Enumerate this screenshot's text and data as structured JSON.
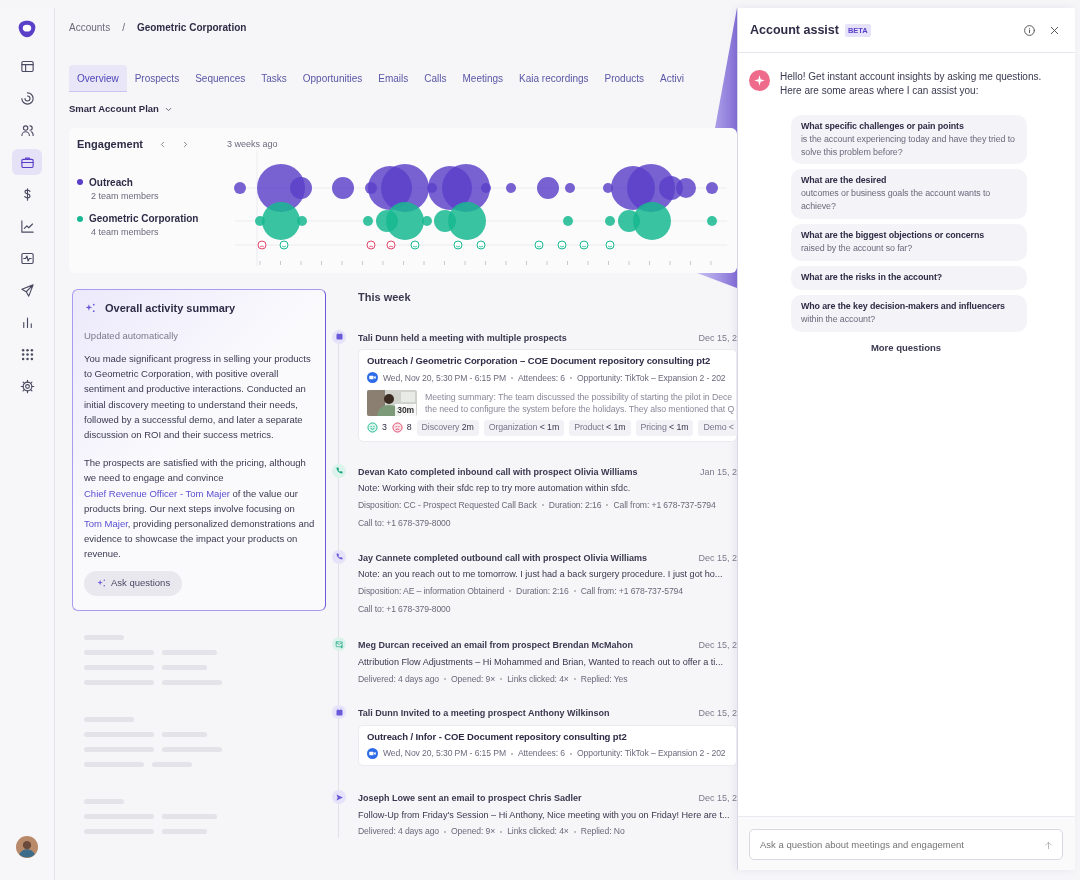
{
  "sidebar": {
    "items": [
      {
        "kind": "layout",
        "selected": false
      },
      {
        "kind": "spiral",
        "selected": false
      },
      {
        "kind": "people",
        "selected": false
      },
      {
        "kind": "briefcase",
        "selected": true
      },
      {
        "kind": "dollar",
        "selected": false
      },
      {
        "kind": "trend",
        "selected": false
      },
      {
        "kind": "pulse",
        "selected": false
      },
      {
        "kind": "send",
        "selected": false
      },
      {
        "kind": "bars",
        "selected": false
      },
      {
        "kind": "apps",
        "selected": false
      },
      {
        "kind": "settings",
        "selected": false
      }
    ]
  },
  "breadcrumb": {
    "items": [
      "Accounts",
      "Geometric Corporation"
    ],
    "separator": "/"
  },
  "tabs": [
    {
      "label": "Overview",
      "selected": true
    },
    {
      "label": "Prospects",
      "selected": false
    },
    {
      "label": "Sequences",
      "selected": false
    },
    {
      "label": "Tasks",
      "selected": false
    },
    {
      "label": "Opportunities",
      "selected": false
    },
    {
      "label": "Emails",
      "selected": false
    },
    {
      "label": "Calls",
      "selected": false
    },
    {
      "label": "Meetings",
      "selected": false
    },
    {
      "label": "Kaia recordings",
      "selected": false
    },
    {
      "label": "Products",
      "selected": false
    },
    {
      "label": "Activi",
      "selected": false
    }
  ],
  "plan_selector": {
    "label": "Smart Account Plan"
  },
  "engagement": {
    "title": "Engagement",
    "period": "3 weeks ago",
    "legend": [
      {
        "name": "Outreach",
        "members": "2 team members",
        "color": "#5a3fc8"
      },
      {
        "name": "Geometric Corporation",
        "members": "4 team members",
        "color": "#17b890"
      }
    ]
  },
  "summary": {
    "title": "Overall activity summary",
    "updated": "Updated automatically",
    "paragraphs": [
      [
        {
          "kind": "text",
          "text": "You made significant progress in selling your products to Geometric Corporation, with positive overall sentiment and productive interactions. Conducted an initial discovery meeting to understand their needs, followed by a successful demo, and later a separate discussion on ROI and their success metrics."
        }
      ],
      [
        {
          "kind": "text",
          "text": "The prospects are satisfied with the pricing, although we need to engage and convince "
        },
        {
          "kind": "link",
          "text": "Chief Revenue Officer - Tom Majer"
        },
        {
          "kind": "text",
          "text": " of the value our products bring. Our next steps involve focusing on "
        },
        {
          "kind": "link",
          "text": "Tom Majer"
        },
        {
          "kind": "text",
          "text": ", providing personalized demonstrations and evidence to showcase the impact your products on revenue."
        }
      ]
    ],
    "button": "Ask questions"
  },
  "timeline": {
    "heading": "This week",
    "events": [
      {
        "kind": "meeting",
        "headline": "Tali Dunn held a meeting with multiple prospects",
        "date": "Dec 15, 2",
        "meeting": {
          "title": "Outreach / Geometric Corporation – COE Document repository consulting pt2",
          "meta": [
            "Wed, Nov 20, 5:30 PM - 6:15 PM",
            "Attendees: 6",
            "Opportunity: TikTok – Expansion 2 - 202"
          ],
          "duration": "30m",
          "summary": [
            "Meeting summary: The team discussed the possibility of starting the pilot in Dece",
            "the need to configure the system before the holidays. They also mentioned that Q"
          ],
          "positive": "3",
          "negative": "8",
          "topics": [
            "Discovery **2m**",
            "Organization **< 1m**",
            "Product **< 1m**",
            "Pricing **< 1m**",
            "Demo <"
          ]
        }
      },
      {
        "kind": "inbound_call",
        "headline": "Devan Kato completed inbound call with prospect Olivia Williams",
        "date": "Jan 15, 2",
        "note": "Note: Working with their sfdc rep to try more automation within sfdc.",
        "meta_lines": [
          [
            "Disposition: CC - Prospect Requested Call Back",
            "Duration: 2:16",
            "Call from: +1 678-737-5794"
          ],
          [
            "Call to:  +1 678-379-8000"
          ]
        ]
      },
      {
        "kind": "outbound_call",
        "headline": "Jay Cannete completed outbound call with prospect Olivia Williams",
        "date": "Dec 15, 2",
        "note": "Note: an you reach out to me tomorrow. I just had a back surgery procedure. I just got ho...",
        "meta_lines": [
          [
            "Disposition: AE – information Obtainerd",
            "Duration: 2:16",
            "Call from: +1 678-737-5794"
          ],
          [
            "Call to:  +1 678-379-8000"
          ]
        ]
      },
      {
        "kind": "email_received",
        "headline": "Meg Durcan received an email from prospect Brendan McMahon",
        "date": "Dec 15, 2",
        "note": "Attribution Flow Adjustments – Hi Mohammed and Brian, Wanted to reach out to offer a ti...",
        "meta_lines": [
          [
            "Delivered: 4 days ago",
            "Opened: 9×",
            "Links clicked: 4×",
            "Replied: Yes"
          ]
        ]
      },
      {
        "kind": "meeting_invite",
        "headline": "Tali Dunn Invited to a meeting prospect Anthony Wilkinson",
        "date": "Dec 15, 2",
        "meeting": {
          "title": "Outreach / Infor - COE Document repository consulting pt2",
          "meta": [
            "Wed, Nov 20, 5:30 PM - 6:15 PM",
            "Attendees: 6",
            "Opportunity: TikTok – Expansion 2 - 202"
          ]
        }
      },
      {
        "kind": "email_sent",
        "headline": "Joseph Lowe sent an email to prospect Chris Sadler",
        "date": "Dec 15, 2",
        "note": "Follow-Up from Friday's Session – Hi Anthony, Nice meeting with you on Friday! Here are t...",
        "meta_lines": [
          [
            "Delivered: 4 days ago",
            "Opened: 9×",
            "Links clicked: 4×",
            "Replied: No"
          ]
        ]
      }
    ]
  },
  "assistant": {
    "title": "Account assist",
    "badge": "BETA",
    "greeting": "Hello! Get instant account insights by asking me questions. Here are some areas where I can assist you:",
    "suggestions": [
      {
        "title": "What specific challenges or pain points",
        "detail": "is the account experiencing today and have they tried to solve this problem before?"
      },
      {
        "title": "What are the desired",
        "detail": "outcomes or business goals the account wants to achieve?"
      },
      {
        "title": "What are the biggest objections or concerns",
        "detail": "raised by the account so far?"
      },
      {
        "title": "What are the risks in the account?"
      },
      {
        "title": "Who are the key decision-makers and influencers",
        "detail": "within the account?"
      }
    ],
    "more": "More questions",
    "input": {
      "placeholder": "Ask a question about meetings and engagement"
    }
  }
}
